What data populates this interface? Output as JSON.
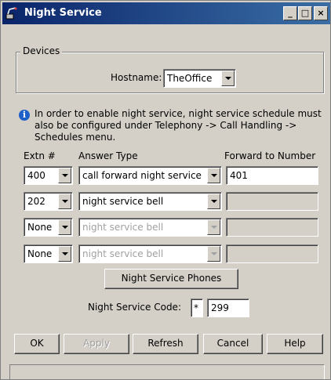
{
  "window": {
    "title": "Night Service",
    "minimize": "_",
    "maximize": "□",
    "close": "×"
  },
  "devices": {
    "group_label": "Devices",
    "hostname_label": "Hostname:",
    "hostname_value": "TheOffice"
  },
  "info": {
    "icon": "info-icon",
    "text": "In order to enable night service, night service schedule must also be configured under Telephony -> Call Handling -> Schedules menu."
  },
  "table": {
    "headers": {
      "extn": "Extn #",
      "answer_type": "Answer Type",
      "forward": "Forward to Number"
    },
    "rows": [
      {
        "extn": "400",
        "answer_type": "call forward night service",
        "forward": "401",
        "enabled": true,
        "forward_enabled": true
      },
      {
        "extn": "202",
        "answer_type": "night service bell",
        "forward": "",
        "enabled": true,
        "forward_enabled": false
      },
      {
        "extn": "None",
        "answer_type": "night service bell",
        "forward": "",
        "enabled": false,
        "forward_enabled": false
      },
      {
        "extn": "None",
        "answer_type": "night service bell",
        "forward": "",
        "enabled": false,
        "forward_enabled": false
      }
    ]
  },
  "phones_button": "Night Service Phones",
  "code": {
    "label": "Night Service Code:",
    "prefix": "*",
    "value": "299"
  },
  "buttons": {
    "ok": "OK",
    "apply": "Apply",
    "refresh": "Refresh",
    "cancel": "Cancel",
    "help": "Help"
  },
  "colors": {
    "title_bar_start": "#0a246a",
    "title_bar_end": "#3a6ea5",
    "dialog_face": "#d4d0c8",
    "info_icon": "#1f5fc8"
  }
}
